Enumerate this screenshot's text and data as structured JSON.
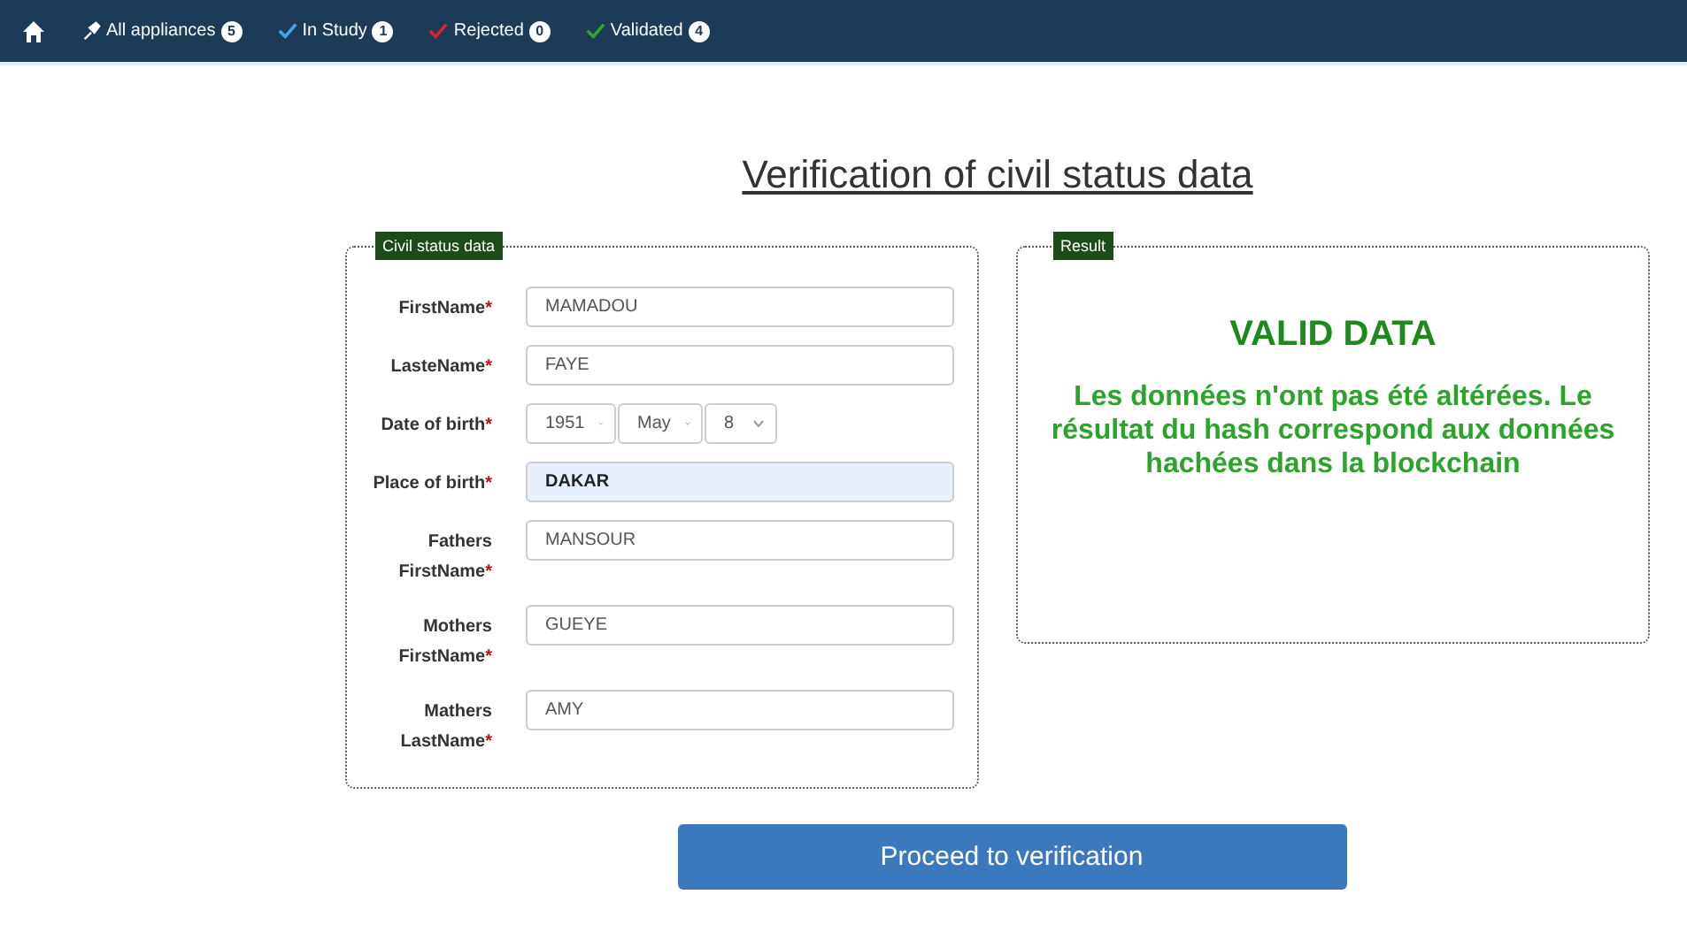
{
  "nav": {
    "items": [
      {
        "label": "All appliances",
        "count": "5",
        "kind": "pin",
        "color": "#ffffff"
      },
      {
        "label": "In Study",
        "count": "1",
        "kind": "check",
        "color": "#3fa9e8"
      },
      {
        "label": "Rejected",
        "count": "0",
        "kind": "check",
        "color": "#e0202a"
      },
      {
        "label": "Validated",
        "count": "4",
        "kind": "check",
        "color": "#2fa82f"
      }
    ]
  },
  "title": "Verification of civil status data",
  "civil_status": {
    "legend": "Civil status data",
    "fields": [
      {
        "kind": "text",
        "label": "FirstName",
        "required_mark": "*",
        "value": "MAMADOU",
        "highlighted": false
      },
      {
        "kind": "text",
        "label": "LasteName",
        "required_mark": "*",
        "value": "FAYE",
        "highlighted": false
      },
      {
        "kind": "date",
        "label": "Date of birth",
        "required_mark": "*",
        "year": "1951",
        "month": "May",
        "day": "8"
      },
      {
        "kind": "text",
        "label": "Place of birth",
        "required_mark": "*",
        "value": "DAKAR",
        "highlighted": true
      },
      {
        "kind": "text",
        "label": "Fathers FirstName",
        "required_mark": "*",
        "value": "MANSOUR",
        "highlighted": false
      },
      {
        "kind": "text",
        "label": "Mothers FirstName",
        "required_mark": "*",
        "value": "GUEYE",
        "highlighted": false
      },
      {
        "kind": "text",
        "label": "Mathers LastName",
        "required_mark": "*",
        "value": "AMY",
        "highlighted": false
      }
    ]
  },
  "result": {
    "legend": "Result",
    "heading": "VALID DATA",
    "message": "Les données n'ont pas été altérées. Le résultat du hash correspond aux données hachées dans la blockchain"
  },
  "verify_button": "Proceed to verification"
}
